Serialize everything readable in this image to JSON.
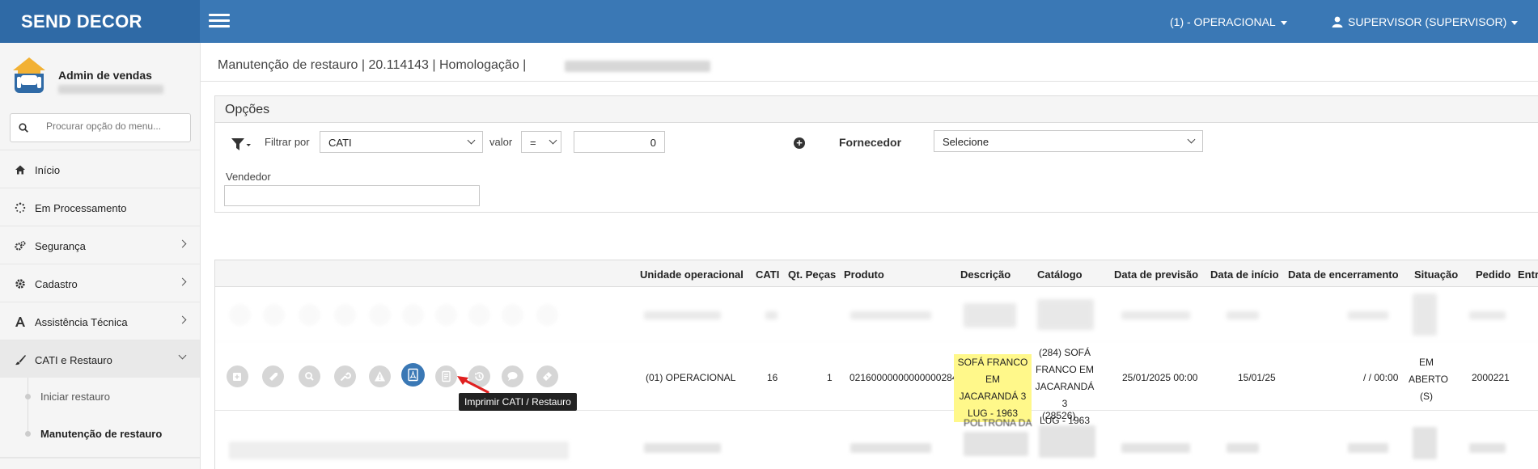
{
  "header": {
    "brand": "SEND DECOR",
    "unit": "(1) - OPERACIONAL",
    "user": "SUPERVISOR (SUPERVISOR)"
  },
  "sidebar": {
    "profile_name": "Admin de vendas",
    "search_placeholder": "Procurar opção do menu...",
    "items": [
      {
        "label": "Início",
        "icon": "home-icon"
      },
      {
        "label": "Em Processamento",
        "icon": "spinner-icon"
      },
      {
        "label": "Segurança",
        "icon": "gears-icon"
      },
      {
        "label": "Cadastro",
        "icon": "gear-icon"
      },
      {
        "label": "Assistência Técnica",
        "icon": "font-icon"
      },
      {
        "label": "CATI e Restauro",
        "icon": "brush-icon"
      }
    ],
    "subitems": [
      {
        "label": "Iniciar restauro"
      },
      {
        "label": "Manutenção de restauro"
      }
    ]
  },
  "breadcrumb": "Manutenção de restauro | 20.114143 | Homologação |",
  "options": {
    "title": "Opções",
    "filter_label": "Filtrar por",
    "filter_value": "CATI",
    "valor_label": "valor",
    "operator": "=",
    "value": "0",
    "fornecedor_label": "Fornecedor",
    "fornecedor_value": "Selecione",
    "vendedor_label": "Vendedor",
    "vendedor_value": ""
  },
  "table": {
    "columns": [
      "Unidade operacional",
      "CATI",
      "Qt. Peças",
      "Produto",
      "Descrição",
      "Catálogo",
      "Data de previsão",
      "Data de início",
      "Data de encerramento",
      "Situação",
      "Pedido",
      "Entr"
    ],
    "row": {
      "unidade": "(01) OPERACIONAL",
      "cati": "16",
      "qt": "1",
      "produto": "02160000000000000284",
      "descricao": [
        "SOFÁ FRANCO",
        "EM JACARANDÁ 3",
        "LUG - 1963"
      ],
      "catalogo": [
        "(284) SOFÁ",
        "FRANCO EM",
        "JACARANDÁ 3",
        "LUG - 1963"
      ],
      "previsao": "25/01/2025 00:00",
      "inicio": "15/01/25",
      "encerramento": "/ / 00:00",
      "situacao": [
        "EM",
        "ABERTO",
        "(S)"
      ],
      "pedido": "2000221"
    },
    "partial_row": {
      "descricao": "POLTRONA DA",
      "catalogo": "(28526)"
    },
    "actions": [
      "add-icon",
      "tag-icon",
      "search-icon",
      "wrench-icon",
      "warning-icon",
      "print-pdf-icon",
      "document-icon",
      "history-icon",
      "comment-icon",
      "ticket-icon"
    ],
    "tooltip": "Imprimir CATI / Restauro"
  },
  "colors": {
    "header": "#3a78b5",
    "brand_bg": "#2f6aa6",
    "highlight": "#fff88a",
    "arrow": "#e02020"
  }
}
